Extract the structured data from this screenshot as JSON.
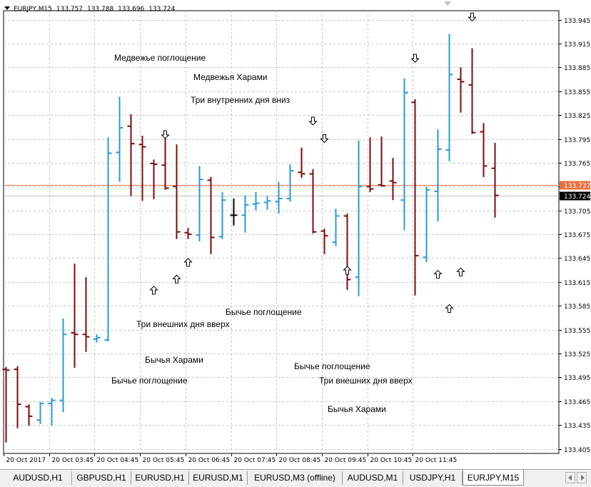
{
  "header": {
    "symbol_period": "EURJPY,M15",
    "ohlc": [
      "133.757",
      "133.788",
      "133.696",
      "133.724"
    ]
  },
  "colors": {
    "bull": "#2a9ad6",
    "bear": "#7b0b0b",
    "neutral": "#000000",
    "grid": "#c4c4c4",
    "ask_line": "#e8703e",
    "bid_line": "#c0c0c0",
    "ask_label_bg": "#e8703e",
    "bid_label_bg": "#000000"
  },
  "price_axis": {
    "labels": [
      "133.945",
      "133.915",
      "133.885",
      "133.855",
      "133.825",
      "133.795",
      "133.765",
      "133.735",
      "133.705",
      "133.675",
      "133.645",
      "133.615",
      "133.585",
      "133.555",
      "133.525",
      "133.495",
      "133.465",
      "133.435",
      "133.405"
    ],
    "ask_label": "133.737",
    "bid_label": "133.724"
  },
  "time_axis": {
    "labels": [
      "20 Oct 2017",
      "20 Oct 03:45",
      "20 Oct 04:45",
      "20 Oct 05:45",
      "20 Oct 06:45",
      "20 Oct 07:45",
      "20 Oct 08:45",
      "20 Oct 09:45",
      "20 Oct 10:45",
      "20 Oct 11:45"
    ]
  },
  "chart_data": {
    "type": "ohlc",
    "symbol": "EURJPY",
    "timeframe": "M15",
    "ylim": [
      133.395,
      133.958
    ],
    "grid": true,
    "bars": [
      {
        "o": 133.505,
        "h": 133.508,
        "l": 133.413,
        "c": 133.504
      },
      {
        "o": 133.505,
        "h": 133.509,
        "l": 133.431,
        "c": 133.461
      },
      {
        "o": 133.458,
        "h": 133.461,
        "l": 133.434,
        "c": 133.446
      },
      {
        "o": 133.441,
        "h": 133.464,
        "l": 133.436,
        "c": 133.462
      },
      {
        "o": 133.462,
        "h": 133.469,
        "l": 133.434,
        "c": 133.466
      },
      {
        "o": 133.466,
        "h": 133.569,
        "l": 133.451,
        "c": 133.549
      },
      {
        "o": 133.551,
        "h": 133.638,
        "l": 133.507,
        "c": 133.549
      },
      {
        "o": 133.549,
        "h": 133.621,
        "l": 133.527,
        "c": 133.546
      },
      {
        "o": 133.543,
        "h": 133.549,
        "l": 133.539,
        "c": 133.545
      },
      {
        "o": 133.542,
        "h": 133.797,
        "l": 133.54,
        "c": 133.777
      },
      {
        "o": 133.778,
        "h": 133.848,
        "l": 133.741,
        "c": 133.809
      },
      {
        "o": 133.811,
        "h": 133.826,
        "l": 133.723,
        "c": 133.789
      },
      {
        "o": 133.788,
        "h": 133.799,
        "l": 133.717,
        "c": 133.785
      },
      {
        "o": 133.764,
        "h": 133.769,
        "l": 133.719,
        "c": 133.763
      },
      {
        "o": 133.762,
        "h": 133.801,
        "l": 133.731,
        "c": 133.733
      },
      {
        "o": 133.735,
        "h": 133.788,
        "l": 133.669,
        "c": 133.678
      },
      {
        "o": 133.677,
        "h": 133.683,
        "l": 133.669,
        "c": 133.675
      },
      {
        "o": 133.674,
        "h": 133.761,
        "l": 133.666,
        "c": 133.744
      },
      {
        "o": 133.743,
        "h": 133.747,
        "l": 133.65,
        "c": 133.671
      },
      {
        "o": 133.672,
        "h": 133.728,
        "l": 133.669,
        "c": 133.718
      },
      {
        "o": 133.699,
        "h": 133.72,
        "l": 133.686,
        "c": 133.699
      },
      {
        "o": 133.699,
        "h": 133.724,
        "l": 133.677,
        "c": 133.712
      },
      {
        "o": 133.713,
        "h": 133.728,
        "l": 133.705,
        "c": 133.714
      },
      {
        "o": 133.715,
        "h": 133.723,
        "l": 133.706,
        "c": 133.717
      },
      {
        "o": 133.716,
        "h": 133.741,
        "l": 133.701,
        "c": 133.72
      },
      {
        "o": 133.72,
        "h": 133.763,
        "l": 133.716,
        "c": 133.755
      },
      {
        "o": 133.753,
        "h": 133.784,
        "l": 133.746,
        "c": 133.751
      },
      {
        "o": 133.751,
        "h": 133.757,
        "l": 133.676,
        "c": 133.678
      },
      {
        "o": 133.679,
        "h": 133.682,
        "l": 133.65,
        "c": 133.673
      },
      {
        "o": 133.665,
        "h": 133.707,
        "l": 133.66,
        "c": 133.698
      },
      {
        "o": 133.698,
        "h": 133.701,
        "l": 133.605,
        "c": 133.618
      },
      {
        "o": 133.621,
        "h": 133.793,
        "l": 133.597,
        "c": 133.735
      },
      {
        "o": 133.735,
        "h": 133.797,
        "l": 133.728,
        "c": 133.732
      },
      {
        "o": 133.737,
        "h": 133.798,
        "l": 133.735,
        "c": 133.736
      },
      {
        "o": 133.742,
        "h": 133.771,
        "l": 133.718,
        "c": 133.74
      },
      {
        "o": 133.718,
        "h": 133.871,
        "l": 133.68,
        "c": 133.853
      },
      {
        "o": 133.841,
        "h": 133.845,
        "l": 133.598,
        "c": 133.648
      },
      {
        "o": 133.646,
        "h": 133.735,
        "l": 133.64,
        "c": 133.731
      },
      {
        "o": 133.729,
        "h": 133.807,
        "l": 133.691,
        "c": 133.782
      },
      {
        "o": 133.781,
        "h": 133.927,
        "l": 133.767,
        "c": 133.876
      },
      {
        "o": 133.87,
        "h": 133.885,
        "l": 133.828,
        "c": 133.867
      },
      {
        "o": 133.863,
        "h": 133.909,
        "l": 133.801,
        "c": 133.803
      },
      {
        "o": 133.804,
        "h": 133.815,
        "l": 133.747,
        "c": 133.761
      },
      {
        "o": 133.758,
        "h": 133.79,
        "l": 133.696,
        "c": 133.724
      }
    ],
    "annotations": [
      {
        "text": "Медвежье поглощение"
      },
      {
        "text": "Медвежья Харами"
      },
      {
        "text": "Три внутренних дня вниз"
      },
      {
        "text": "Бычье поглощение"
      },
      {
        "text": "Три внешних дня вверх"
      },
      {
        "text": "Бычья Харами"
      },
      {
        "text": "Бычье поглощение"
      },
      {
        "text": "Бычье поглощение"
      },
      {
        "text": "Три внешних дня вверх"
      },
      {
        "text": "Бычья Харами"
      }
    ],
    "arrows": [
      {
        "dir": "down",
        "bar": 14,
        "price": 133.8
      },
      {
        "dir": "down",
        "bar": 27,
        "price": 133.817
      },
      {
        "dir": "down",
        "bar": 28,
        "price": 133.795
      },
      {
        "dir": "down",
        "bar": 36,
        "price": 133.896
      },
      {
        "dir": "down",
        "bar": 41,
        "price": 133.948
      },
      {
        "dir": "up",
        "bar": 13,
        "price": 133.605
      },
      {
        "dir": "up",
        "bar": 15,
        "price": 133.619
      },
      {
        "dir": "up",
        "bar": 16,
        "price": 133.64
      },
      {
        "dir": "up",
        "bar": 30,
        "price": 133.63
      },
      {
        "dir": "up",
        "bar": 38,
        "price": 133.625
      },
      {
        "dir": "up",
        "bar": 39,
        "price": 133.582
      },
      {
        "dir": "up",
        "bar": 40,
        "price": 133.628
      }
    ]
  },
  "tabs": [
    {
      "label": "AUDUSD,H1",
      "active": false
    },
    {
      "label": "GBPUSD,H1",
      "active": false
    },
    {
      "label": "EURUSD,H1",
      "active": false
    },
    {
      "label": "EURUSD,M1",
      "active": false
    },
    {
      "label": "EURUSD,M3 (offline)",
      "active": false
    },
    {
      "label": "AUDUSD,M1",
      "active": false
    },
    {
      "label": "USDJPY,H1",
      "active": false
    },
    {
      "label": "EURJPY,M15",
      "active": true
    }
  ]
}
